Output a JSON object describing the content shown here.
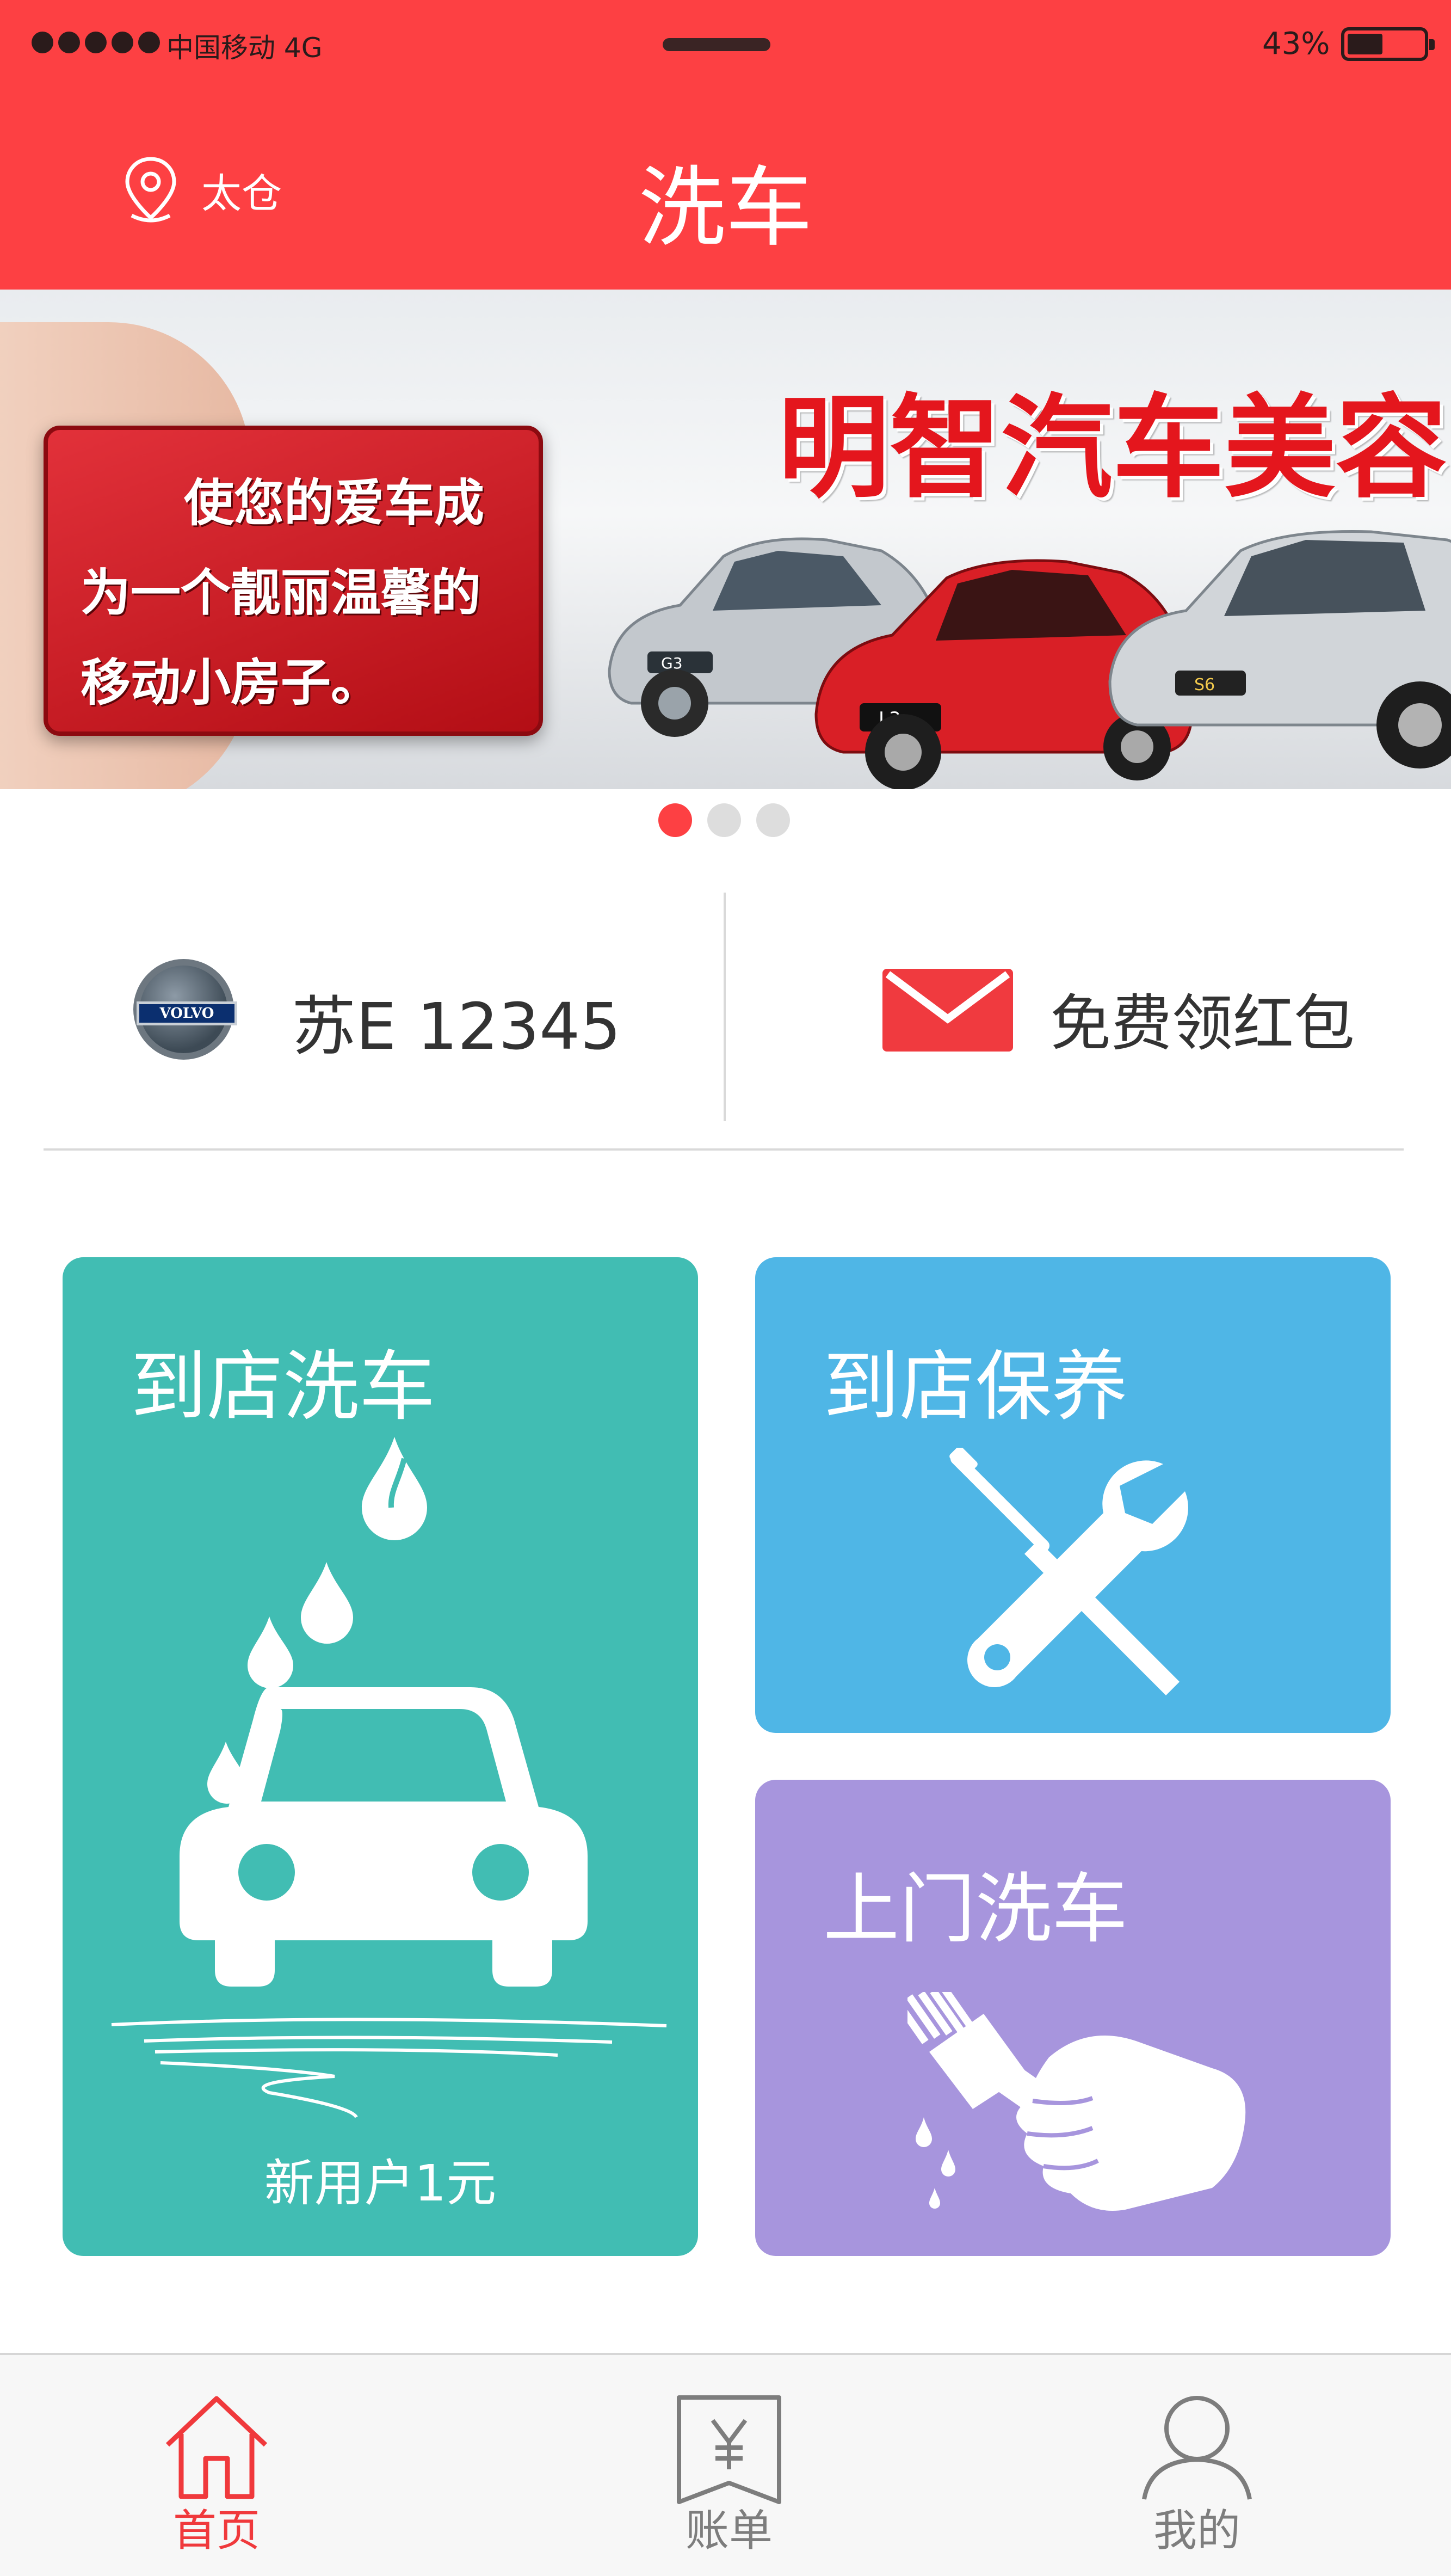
{
  "status_bar": {
    "carrier": "中国移动",
    "network": "4G",
    "battery": "43%",
    "battery_level": 0.43
  },
  "header": {
    "location": "太仓",
    "location_icon": "location-pin-icon",
    "title": "洗车",
    "background": "#fd4043"
  },
  "banner": {
    "card_lines": [
      "使您的爱车成",
      "为一个靓丽温馨的",
      "移动小房子。"
    ],
    "headline": "明智汽车美容",
    "car_plates": [
      "G3",
      "L3",
      "S6"
    ],
    "slides": 3,
    "active_slide": 1
  },
  "car_info": {
    "brand_logo": "volvo-logo",
    "brand_text": "VOLVO",
    "plate": "苏E 12345",
    "red_packet_icon": "envelope-icon",
    "red_packet": "免费领红包"
  },
  "services": {
    "wash": {
      "label": "到店洗车",
      "promo": "新用户1元",
      "icon": "car-wash-icon",
      "color": "#41bdb3"
    },
    "maintenance": {
      "label": "到店保养",
      "icon": "wrench-screwdriver-icon",
      "color": "#4fb6e6"
    },
    "home_wash": {
      "label": "上门洗车",
      "icon": "hand-brush-icon",
      "color": "#a795dd"
    }
  },
  "tabs": [
    {
      "label": "首页",
      "icon": "home-icon",
      "active": true
    },
    {
      "label": "账单",
      "icon": "bill-icon",
      "active": false
    },
    {
      "label": "我的",
      "icon": "profile-icon",
      "active": false
    }
  ],
  "accent_color": "#f0393c"
}
